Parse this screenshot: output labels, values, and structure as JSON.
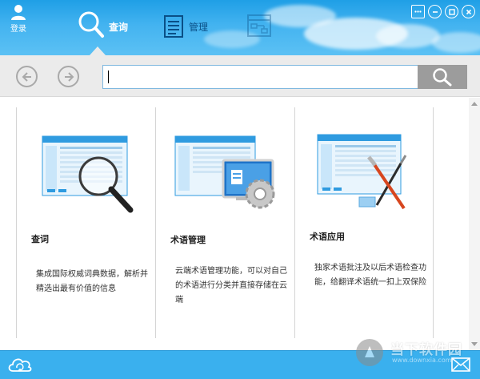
{
  "header": {
    "login_label": "登录",
    "tabs": [
      {
        "label": "查询",
        "icon": "magnifier-icon",
        "active": true
      },
      {
        "label": "管理",
        "icon": "document-list-icon",
        "active": false
      },
      {
        "label": "",
        "icon": "workflow-icon",
        "active": false
      }
    ],
    "window_controls": [
      "feedback-icon",
      "minimize-icon",
      "restore-icon",
      "close-icon"
    ]
  },
  "toolbar": {
    "back_icon": "back-arrow-icon",
    "forward_icon": "forward-arrow-icon",
    "search_value": "",
    "search_icon": "search-icon"
  },
  "cards": [
    {
      "title": "查词",
      "description": "集成国际权威词典数据，解析并精选出最有价值的信息",
      "illustration": "magnifier-over-app-icon"
    },
    {
      "title": "术语管理",
      "description": "云端术语管理功能，可以对自己的术语进行分类并直接存储在云端",
      "illustration": "gear-over-app-icon"
    },
    {
      "title": "术语应用",
      "description": "独家术语批注及以后术语检查功能，给翻译术语统一扣上双保险",
      "illustration": "brush-over-app-icon"
    }
  ],
  "footer": {
    "cloud_icon": "cloud-sync-icon",
    "mail_icon": "mail-icon"
  },
  "watermark": {
    "text": "当下软件园",
    "url": "www.downxia.com"
  },
  "colors": {
    "header_blue": "#2aa6ec",
    "footer_blue": "#3ab0ee",
    "toolbar_gray": "#ebebeb",
    "search_button": "#9c9c9c"
  }
}
